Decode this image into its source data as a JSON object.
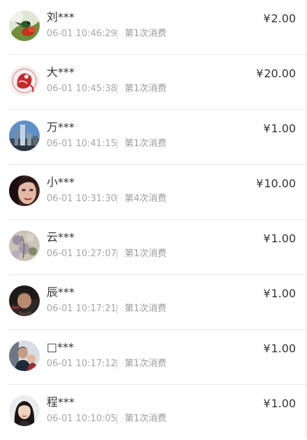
{
  "currency_symbol": "¥",
  "separator": "|",
  "records": [
    {
      "name": "刘***",
      "time": "06-01 10:46:29",
      "count": "第1次消费",
      "amount": "2.00",
      "avatar_icon": "bird-flower-avatar-icon"
    },
    {
      "name": "大***",
      "time": "06-01 10:45:38",
      "count": "第1次消费",
      "amount": "20.00",
      "avatar_icon": "red-monkey-papercut-avatar-icon"
    },
    {
      "name": "万***",
      "time": "06-01 10:41:15",
      "count": "第1次消费",
      "amount": "1.00",
      "avatar_icon": "city-skyline-avatar-icon"
    },
    {
      "name": "小***",
      "time": "06-01 10:31:30",
      "count": "第4次消费",
      "amount": "10.00",
      "avatar_icon": "woman-face-avatar-icon"
    },
    {
      "name": "云***",
      "time": "06-01 10:27:07",
      "count": "第1次消费",
      "amount": "1.00",
      "avatar_icon": "floral-painting-avatar-icon"
    },
    {
      "name": "辰***",
      "time": "06-01 10:17:21",
      "count": "第1次消费",
      "amount": "1.00",
      "avatar_icon": "man-portrait-avatar-icon"
    },
    {
      "name": "□***",
      "time": "06-01 10:17:12",
      "count": "第1次消费",
      "amount": "1.00",
      "avatar_icon": "man-with-child-avatar-icon"
    },
    {
      "name": "程***",
      "time": "06-01 10:10:05",
      "count": "第1次消费",
      "amount": "1.00",
      "avatar_icon": "girl-portrait-avatar-icon"
    }
  ]
}
